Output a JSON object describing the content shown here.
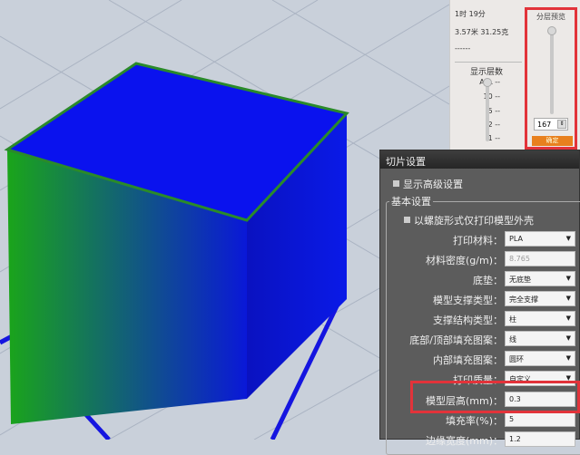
{
  "stats": {
    "time": "1时 19分",
    "usage": "3.57米 31.25克",
    "dashes": "------"
  },
  "layers": {
    "title": "显示层数",
    "ticks": [
      "ALL --",
      "10 --",
      "5 --",
      "2 --",
      "1 --"
    ]
  },
  "preview": {
    "title": "分层预览",
    "value": "167",
    "confirm": "确定"
  },
  "dialog": {
    "title": "切片设置",
    "advanced": "显示高级设置",
    "group": "基本设置",
    "spiral": "以螺旋形式仅打印模型外壳",
    "rows": [
      {
        "label": "打印材料：",
        "value": "PLA",
        "type": "select"
      },
      {
        "label": "材料密度(g/m)：",
        "value": "8.765",
        "type": "disabled"
      },
      {
        "label": "底垫：",
        "value": "无底垫",
        "type": "select"
      },
      {
        "label": "模型支撑类型：",
        "value": "完全支撑",
        "type": "select"
      },
      {
        "label": "支撑结构类型：",
        "value": "柱",
        "type": "select"
      },
      {
        "label": "底部/顶部填充图案：",
        "value": "线",
        "type": "select"
      },
      {
        "label": "内部填充图案：",
        "value": "圆环",
        "type": "select"
      },
      {
        "label": "打印质量：",
        "value": "自定义...",
        "type": "select"
      },
      {
        "label": "模型层高(mm)：",
        "value": "0.3",
        "type": "input"
      },
      {
        "label": "填充率(%)：",
        "value": "5",
        "type": "input"
      },
      {
        "label": "边缘宽度(mm)：",
        "value": "1.2",
        "type": "input"
      }
    ]
  },
  "colors": {
    "highlight": "#e2333a",
    "cube": "#0a14ee",
    "accent": "#e8801e"
  }
}
